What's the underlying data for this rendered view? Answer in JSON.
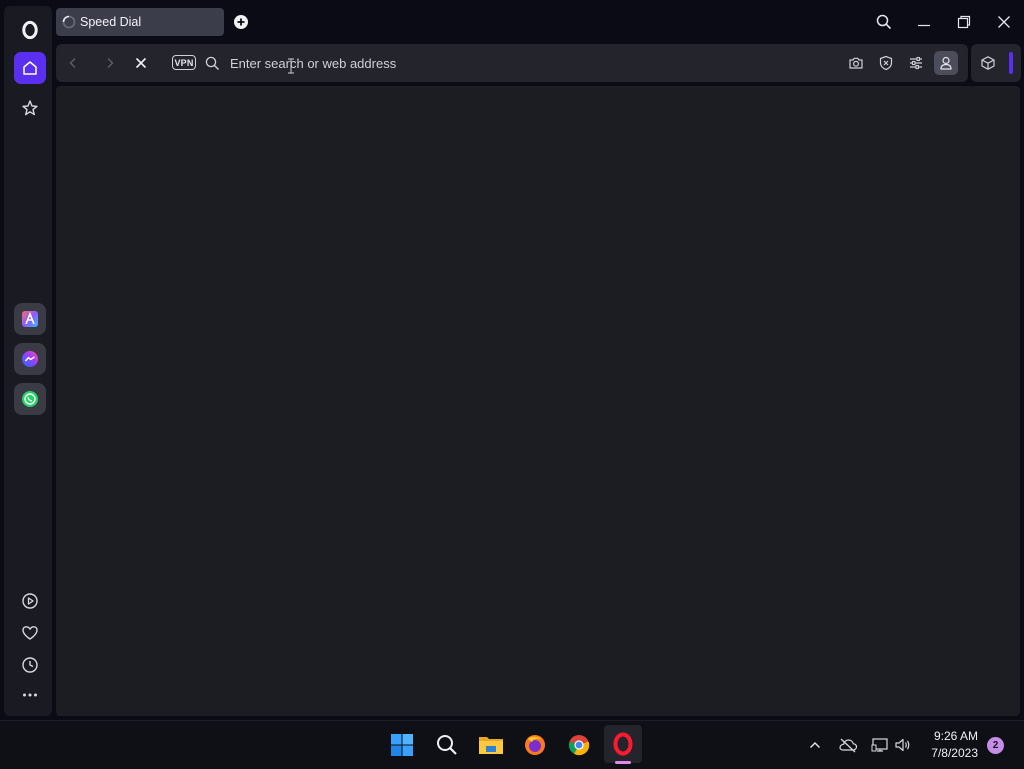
{
  "browser": {
    "tab": {
      "title": "Speed Dial",
      "loading": true
    },
    "address_bar": {
      "placeholder": "Enter search or web address",
      "value": ""
    },
    "vpn_badge": "VPN",
    "accent_color": "#5b2ff0"
  },
  "sidebar": {
    "top_items": [
      "opera-logo",
      "home",
      "speed-dial-pinboard"
    ],
    "apps": [
      "aria",
      "messenger",
      "whatsapp"
    ],
    "bottom_items": [
      "player",
      "favorites",
      "history",
      "more"
    ]
  },
  "taskbar": {
    "apps": [
      "start",
      "search",
      "file-explorer",
      "firefox",
      "chrome",
      "opera"
    ],
    "time": "9:26 AM",
    "date": "7/8/2023",
    "notification_count": "2"
  }
}
